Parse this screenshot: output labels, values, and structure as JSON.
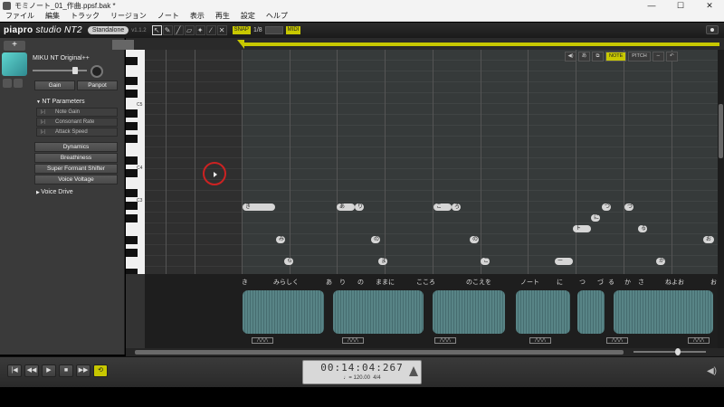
{
  "window": {
    "title": "モミノート_01_作曲.ppsf.bak *",
    "min": "—",
    "max": "☐",
    "close": "✕"
  },
  "menu": [
    "ファイル",
    "編集",
    "トラック",
    "リージョン",
    "ノート",
    "表示",
    "再生",
    "設定",
    "ヘルプ"
  ],
  "toolbar": {
    "logo": "piapro",
    "logo_sub": "studio NT2",
    "mode": "Standalone",
    "version": "v1.1.2",
    "tools": [
      "pointer-icon",
      "pencil-icon",
      "line-icon",
      "eraser-icon",
      "brush-icon",
      "knife-icon",
      "scissors-icon"
    ],
    "snap_label": "SNAP",
    "snap_value": "1/8",
    "quantize_label": "MIDI"
  },
  "panel": {
    "add": "+",
    "voice_name": "MIKU NT Original++",
    "gain": "Gain",
    "panpot": "Panpot",
    "nt_parameters": "NT Parameters",
    "note_gain": "Note Gain",
    "consonant_rate": "Consonant Rate",
    "attack_speed": "Attack Speed",
    "dynamics": "Dynamics",
    "breathiness": "Breathiness",
    "super_formant": "Super Formant Shifter",
    "voice_voltage": "Voice Voltage",
    "voice_drive": "Voice Drive"
  },
  "piano": {
    "labels": [
      "C5",
      "C4",
      "C3"
    ]
  },
  "roll_controls": {
    "note": "NOTE",
    "pitch": "PITCH"
  },
  "notes": [
    {
      "label": "き",
      "row": 14,
      "start": 108,
      "len": 36
    },
    {
      "label": "み",
      "row": 17,
      "start": 145,
      "len": 8
    },
    {
      "label": "ら",
      "row": 19,
      "start": 154,
      "len": 8
    },
    {
      "label": "し",
      "row": 21,
      "start": 166,
      "len": 20
    },
    {
      "label": "く",
      "row": 21,
      "start": 186,
      "len": 8
    },
    {
      "label": "あ",
      "row": 14,
      "start": 212,
      "len": 20
    },
    {
      "label": "り",
      "row": 14,
      "start": 232,
      "len": 8
    },
    {
      "label": "の",
      "row": 17,
      "start": 250,
      "len": 8
    },
    {
      "label": "ま",
      "row": 19,
      "start": 258,
      "len": 8
    },
    {
      "label": "ま",
      "row": 21,
      "start": 266,
      "len": 8
    },
    {
      "label": "に",
      "row": 21,
      "start": 276,
      "len": 8
    },
    {
      "label": "こ",
      "row": 21,
      "start": 305,
      "len": 8
    },
    {
      "label": "こ",
      "row": 14,
      "start": 319,
      "len": 20
    },
    {
      "label": "ろ",
      "row": 14,
      "start": 339,
      "len": 8
    },
    {
      "label": "の",
      "row": 17,
      "start": 359,
      "len": 8
    },
    {
      "label": "こ",
      "row": 19,
      "start": 371,
      "len": 8
    },
    {
      "label": "え",
      "row": 21,
      "start": 383,
      "len": 8
    },
    {
      "label": "を",
      "row": 21,
      "start": 393,
      "len": 8
    },
    {
      "label": "ノ",
      "row": 21,
      "start": 423,
      "len": 30
    },
    {
      "label": "ー",
      "row": 19,
      "start": 453,
      "len": 20
    },
    {
      "label": "ト",
      "row": 16,
      "start": 473,
      "len": 20
    },
    {
      "label": "に",
      "row": 15,
      "start": 493,
      "len": 8
    },
    {
      "label": "つ",
      "row": 14,
      "start": 505,
      "len": 8
    },
    {
      "label": "づ",
      "row": 14,
      "start": 530,
      "len": 8
    },
    {
      "label": "る",
      "row": 16,
      "start": 545,
      "len": 8
    },
    {
      "label": "か",
      "row": 19,
      "start": 565,
      "len": 8
    },
    {
      "label": "さ",
      "row": 21,
      "start": 575,
      "len": 8
    },
    {
      "label": "ね",
      "row": 21,
      "start": 590,
      "len": 8
    },
    {
      "label": "お",
      "row": 21,
      "start": 606,
      "len": 8
    },
    {
      "label": "お",
      "row": 17,
      "start": 617,
      "len": 12
    }
  ],
  "lyrics": [
    "き",
    "みらしく",
    "あ",
    "り",
    "の",
    "ままに",
    "こころ",
    "のこえを",
    "ノート",
    "に",
    "つ",
    "づ",
    "る",
    "か",
    "さ",
    "ねよお",
    "お"
  ],
  "transport": {
    "time": "00:14:04:267",
    "tempo": "♩= 120.00",
    "timesig": "4/4",
    "buttons": [
      "|◀",
      "◀◀",
      "▶",
      "■",
      "▶▶",
      "⟲"
    ]
  }
}
